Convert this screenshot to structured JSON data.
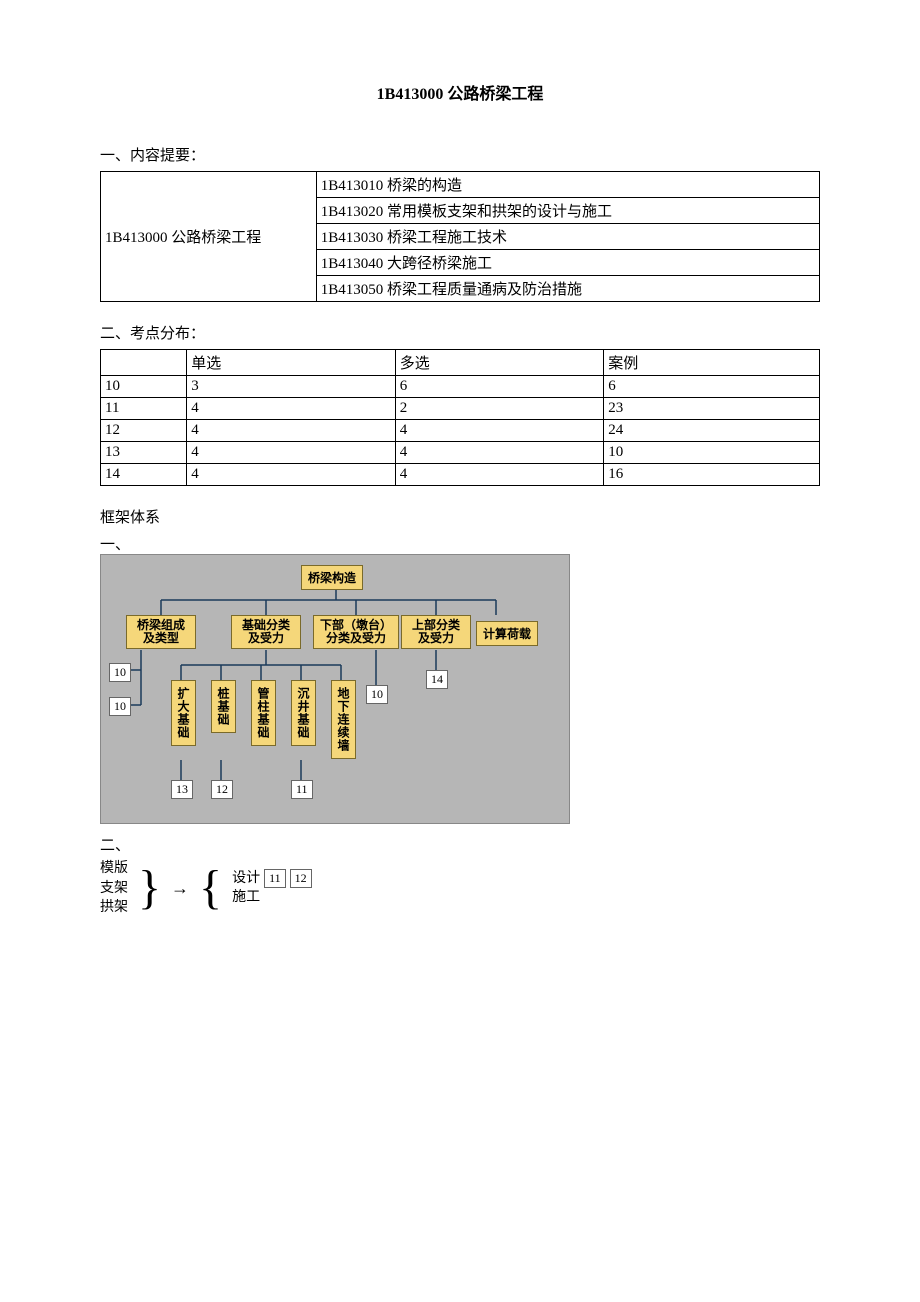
{
  "title": "1B413000  公路桥梁工程",
  "section1": {
    "heading": "一、内容提要：",
    "leftCell": "1B413000 公路桥梁工程",
    "rows": [
      "1B413010 桥梁的构造",
      "1B413020 常用模板支架和拱架的设计与施工",
      "1B413030 桥梁工程施工技术",
      "1B413040 大跨径桥梁施工",
      "1B413050 桥梁工程质量通病及防治措施"
    ]
  },
  "section2": {
    "heading": "二、考点分布：",
    "headers": [
      "",
      "单选",
      "多选",
      "案例"
    ],
    "rows": [
      [
        "10",
        "3",
        "6",
        "6"
      ],
      [
        "11",
        "4",
        "2",
        "23"
      ],
      [
        "12",
        "4",
        "4",
        "24"
      ],
      [
        "13",
        "4",
        "4",
        "10"
      ],
      [
        "14",
        "4",
        "4",
        "16"
      ]
    ]
  },
  "framework": {
    "heading": "框架体系",
    "sub1": "一、",
    "sub2": "二、",
    "diagram1": {
      "root": "桥梁构造",
      "level2": [
        "桥梁组成及类型",
        "基础分类及受力",
        "下部（墩台）分类及受力",
        "上部分类及受力",
        "计算荷载"
      ],
      "foundations": [
        "扩大基础",
        "桩基础",
        "管柱基础",
        "沉井基础",
        "地下连续墙"
      ],
      "nums": {
        "g1a": "10",
        "g1b": "10",
        "g3": "10",
        "g4": "14",
        "f1": "13",
        "f2": "12",
        "f4": "11"
      }
    },
    "diagram2": {
      "left": [
        "模版",
        "支架",
        "拱架"
      ],
      "right": [
        {
          "label": "设计",
          "boxes": [
            "11",
            "12"
          ]
        },
        {
          "label": "施工",
          "boxes": []
        }
      ]
    }
  }
}
